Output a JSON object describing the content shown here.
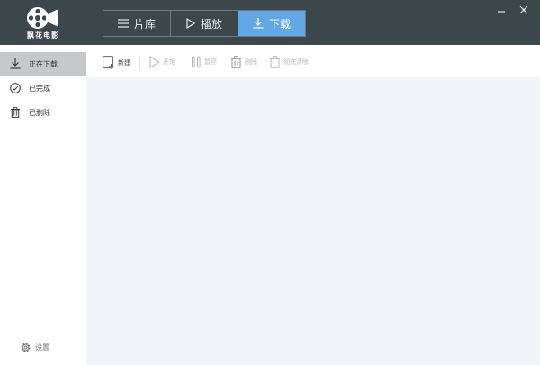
{
  "app": {
    "logo_text": "飘花电影",
    "colors": {
      "titlebar": "#3c474b",
      "active_tab": "#62a8e6",
      "sidebar_active": "#c5c9cc",
      "content_bg": "#f3f4f9"
    }
  },
  "tabs": [
    {
      "label": "片库",
      "icon": "list-icon",
      "active": false
    },
    {
      "label": "播放",
      "icon": "play-icon",
      "active": false
    },
    {
      "label": "下载",
      "icon": "download-icon",
      "active": true
    }
  ],
  "window_controls": {
    "minimize_icon": "minimize-icon",
    "close_icon": "close-icon"
  },
  "sidebar": {
    "items": [
      {
        "label": "正在下载",
        "icon": "download-icon",
        "active": true
      },
      {
        "label": "已完成",
        "icon": "check-circle-icon",
        "active": false
      },
      {
        "label": "已删除",
        "icon": "trash-icon",
        "active": false
      }
    ],
    "settings_label": "设置"
  },
  "toolbar": {
    "new_label": "新建",
    "start_label": "开始",
    "pause_label": "暂停",
    "delete_label": "删除",
    "clear_label": "彻底清除"
  }
}
